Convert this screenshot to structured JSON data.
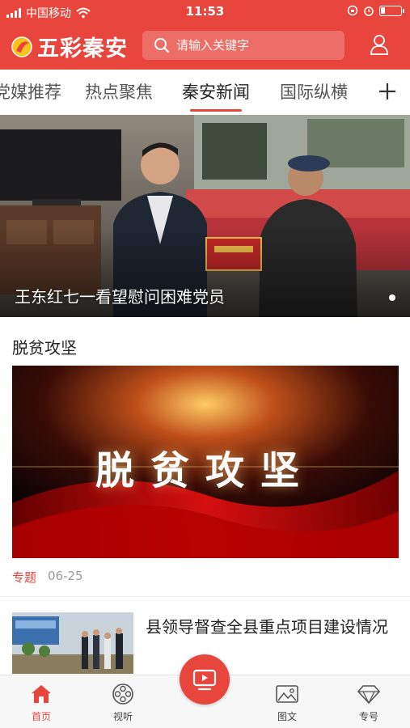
{
  "status_bar": {
    "carrier": "中国移动",
    "time": "11:53"
  },
  "app": {
    "name": "五彩秦安",
    "search_placeholder": "请输入关键字"
  },
  "tabs": [
    {
      "label": "党媒推荐",
      "active": false
    },
    {
      "label": "热点聚焦",
      "active": false
    },
    {
      "label": "秦安新闻",
      "active": true
    },
    {
      "label": "国际纵横",
      "active": false
    }
  ],
  "hero": {
    "caption": "王东红七一看望慰问困难党员"
  },
  "section": {
    "title": "脱贫攻坚",
    "feature_text": "脱贫攻坚",
    "tag": "专题",
    "date": "06-25"
  },
  "article": {
    "title": "县领导督查全县重点项目建设情况"
  },
  "bottom_nav": [
    {
      "label": "首页",
      "icon": "home-icon",
      "active": true
    },
    {
      "label": "视听",
      "icon": "film-reel-icon",
      "active": false
    },
    {
      "label": "图文",
      "icon": "image-icon",
      "active": false
    },
    {
      "label": "专号",
      "icon": "diamond-icon",
      "active": false
    }
  ],
  "colors": {
    "brand": "#e8463c",
    "tab_underline": "#e8463c",
    "nav_bg": "#f7f7f7"
  }
}
